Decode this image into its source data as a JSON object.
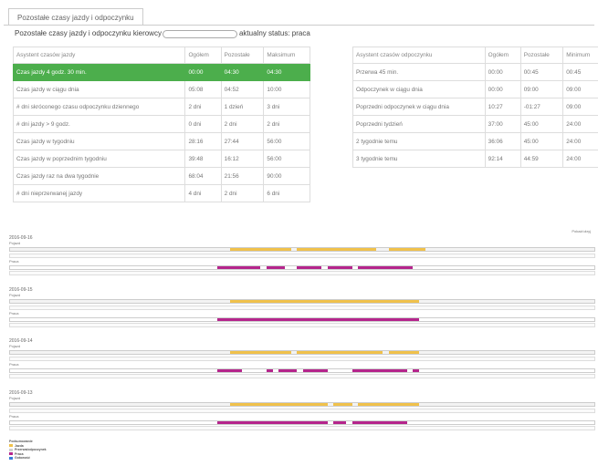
{
  "tab": {
    "label": "Pozostałe czasy jazdy i odpoczynku"
  },
  "status": {
    "label": "Pozostałe czasy jazdy i odpoczynku kierowcy",
    "input_value": "",
    "status_text": "aktualny status: praca"
  },
  "driving": {
    "headers": [
      "Asystent czasów jazdy",
      "Ogółem",
      "Pozostałe",
      "Maksimum"
    ],
    "rows": [
      [
        "Czas jazdy 4 godz. 30 min.",
        "00:00",
        "04:30",
        "04:30"
      ],
      [
        "Czas jazdy w ciągu dnia",
        "05:08",
        "04:52",
        "10:00"
      ],
      [
        "# dni skróconego czasu odpoczynku dziennego",
        "2 dni",
        "1 dzień",
        "3 dni"
      ],
      [
        "# dni jazdy > 9 godz.",
        "0 dni",
        "2 dni",
        "2 dni"
      ],
      [
        "Czas jazdy w tygodniu",
        "28:16",
        "27:44",
        "56:00"
      ],
      [
        "Czas jazdy w poprzednim tygodniu",
        "39:48",
        "16:12",
        "56:00"
      ],
      [
        "Czas jazdy raz na dwa tygodnie",
        "68:04",
        "21:56",
        "90:00"
      ],
      [
        "# dni nieprzerwanej jazdy",
        "4 dni",
        "2 dni",
        "6 dni"
      ]
    ]
  },
  "rest": {
    "headers": [
      "Asystent czasów odpoczynku",
      "Ogółem",
      "Pozostałe",
      "Minimum"
    ],
    "rows": [
      [
        "Przerwa 45 min.",
        "00:00",
        "00:45",
        "00:45"
      ],
      [
        "Odpoczynek w ciągu dnia",
        "00:00",
        "09:00",
        "09:00"
      ],
      [
        "Poprzedni odpoczynek w ciągu dnia",
        "10:27",
        "-01:27",
        "09:00"
      ],
      [
        "Poprzedni tydzień",
        "37:00",
        "45:00",
        "24:00"
      ],
      [
        "2 tygodnie temu",
        "36:06",
        "45:00",
        "24:00"
      ],
      [
        "3 tygodnie temu",
        "92:14",
        "44:59",
        "24:00"
      ]
    ]
  },
  "timeline_legend_top": "Pokaż/ukryj",
  "days": [
    {
      "date": "2016-09-16",
      "row1": "Pojazd",
      "row2": "Praca"
    },
    {
      "date": "2016-09-15",
      "row1": "Pojazd",
      "row2": "Praca"
    },
    {
      "date": "2016-09-14",
      "row1": "Pojazd",
      "row2": "Praca"
    },
    {
      "date": "2016-09-13",
      "row1": "Pojazd",
      "row2": "Praca"
    }
  ],
  "legend": {
    "title": "Podsumowanie",
    "items": [
      "Jazda",
      "Przerwa/odpoczynek",
      "Praca",
      "Gotowość"
    ]
  },
  "colors": {
    "driving": "#f0c14b",
    "work": "#b5258c",
    "rest": "#cfcfcf",
    "green": "#4cae4c"
  }
}
